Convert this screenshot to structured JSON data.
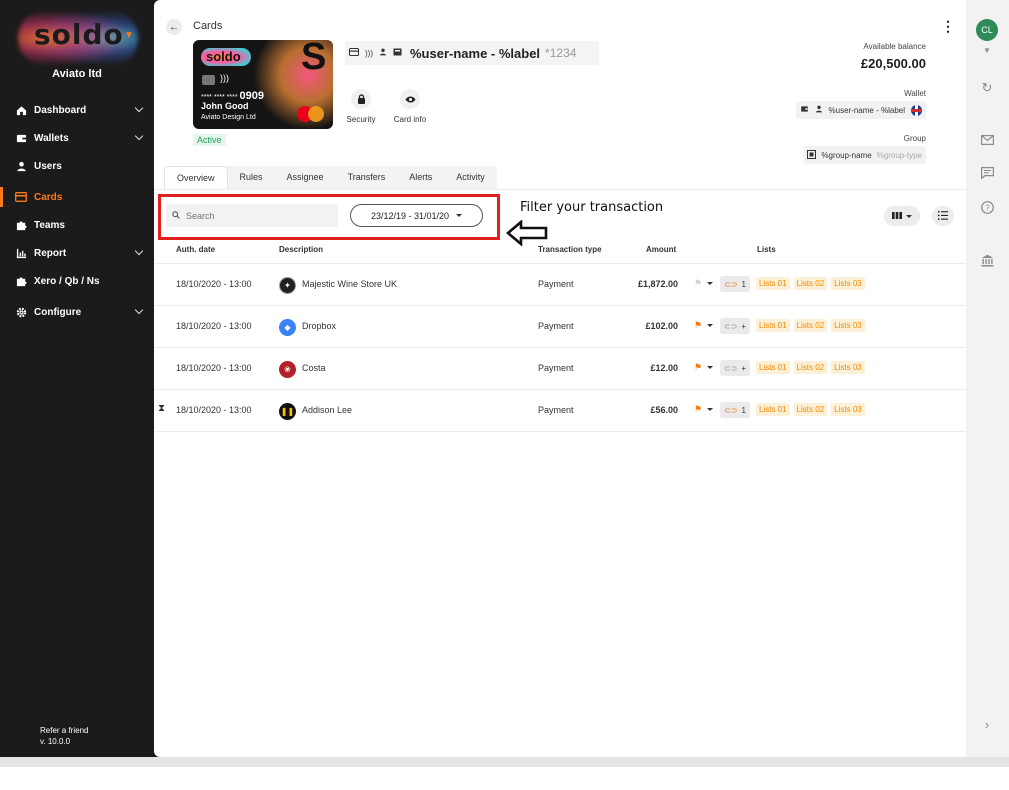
{
  "sidebar": {
    "logo_text": "soldo",
    "org_name": "Aviato ltd",
    "items": [
      {
        "label": "Dashboard",
        "icon": "home-icon",
        "has_chevron": true
      },
      {
        "label": "Wallets",
        "icon": "wallet-icon",
        "has_chevron": true
      },
      {
        "label": "Users",
        "icon": "user-icon",
        "has_chevron": false
      },
      {
        "label": "Cards",
        "icon": "card-icon",
        "has_chevron": false,
        "active": true
      },
      {
        "label": "Teams",
        "icon": "puzzle-icon",
        "has_chevron": false
      },
      {
        "label": "Report",
        "icon": "bar-chart-icon",
        "has_chevron": true
      },
      {
        "label": "Xero / Qb / Ns",
        "icon": "puzzle-icon",
        "has_chevron": false
      },
      {
        "label": "Configure",
        "icon": "gear-icon",
        "has_chevron": true
      }
    ],
    "refer": "Refer a friend",
    "version": "v. 10.0.0"
  },
  "header": {
    "breadcrumb": "Cards",
    "card_label": "%user-name - %label",
    "card_last4": "*1234",
    "status": "Active"
  },
  "card_image": {
    "logo": "soldo",
    "number_mask": "**** **** ****",
    "number_last": "0909",
    "holder": "John Good",
    "company": "Aviato Design Ltd"
  },
  "actions": [
    {
      "label": "Security",
      "icon": "lock-icon"
    },
    {
      "label": "Card info",
      "icon": "eye-icon"
    }
  ],
  "balance": {
    "label": "Available balance",
    "value": "£20,500.00"
  },
  "wallet": {
    "label": "Wallet",
    "value": "%user-name - %label"
  },
  "group": {
    "label": "Group",
    "name": "%group-name",
    "type": "%group-type"
  },
  "tabs": [
    "Overview",
    "Rules",
    "Assignee",
    "Transfers",
    "Alerts",
    "Activity"
  ],
  "filters": {
    "search_placeholder": "Search",
    "date_range": "23/12/19 - 31/01/20"
  },
  "annotation": "Filter your transaction",
  "table": {
    "headers": [
      "Auth. date",
      "Description",
      "Transaction type",
      "Amount",
      "Lists"
    ],
    "rows": [
      {
        "date": "18/10/2020 - 13:00",
        "merchant": "Majestic Wine Store UK",
        "type": "Payment",
        "amount": "£1,872.00",
        "receipt": "1",
        "lists": [
          "Lists 01",
          "Lists 02",
          "Lists 03"
        ]
      },
      {
        "date": "18/10/2020 - 13:00",
        "merchant": "Dropbox",
        "type": "Payment",
        "amount": "£102.00",
        "receipt": "+",
        "lists": [
          "Lists 01",
          "Lists 02",
          "Lists 03"
        ]
      },
      {
        "date": "18/10/2020 - 13:00",
        "merchant": "Costa",
        "type": "Payment",
        "amount": "£12.00",
        "receipt": "+",
        "lists": [
          "Lists 01",
          "Lists 02",
          "Lists 03"
        ]
      },
      {
        "date": "18/10/2020 - 13:00",
        "merchant": "Addison Lee",
        "type": "Payment",
        "amount": "£56.00",
        "receipt": "1",
        "lists": [
          "Lists 01",
          "Lists 02",
          "Lists 03"
        ]
      }
    ]
  },
  "user": {
    "initials": "CL"
  },
  "colors": {
    "accent": "#ff7a1a",
    "highlight": "#e01f1f",
    "active_badge": "#1f9d55"
  }
}
